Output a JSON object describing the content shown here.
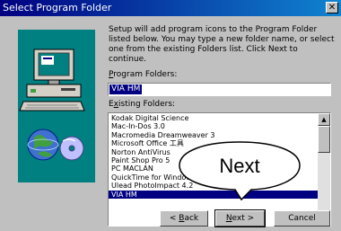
{
  "window": {
    "title": "Select Program Folder",
    "close_glyph": "✕"
  },
  "description": "Setup will add program icons to the Program Folder listed below. You may type a new folder name, or select one from the existing Folders list. Click Next to continue.",
  "program_folders": {
    "label_underlined": "P",
    "label_rest": "rogram Folders:",
    "value": "VIA HM"
  },
  "existing_folders": {
    "label_first": "E",
    "label_underlined": "x",
    "label_rest": "isting Folders:",
    "items": [
      "Kodak Digital Science",
      "Mac-In-Dos 3.0",
      "Macromedia Dreamweaver 3",
      "Microsoft Office 工具",
      "Norton AntiVirus",
      "Paint Shop Pro 5",
      "PC MACLAN",
      "QuickTime for Windows",
      "Ulead PhotoImpact 4.2",
      "VIA HM"
    ],
    "selected_index": 9
  },
  "buttons": {
    "back_arrow": "< ",
    "back_underlined": "B",
    "back_rest": "ack",
    "next_underlined": "N",
    "next_rest": "ext >",
    "cancel": "Cancel"
  },
  "callout": {
    "text": "Next"
  },
  "icons": [
    "close-icon",
    "computer-icon",
    "globe-icon",
    "scroll-up-icon",
    "scroll-down-icon"
  ]
}
